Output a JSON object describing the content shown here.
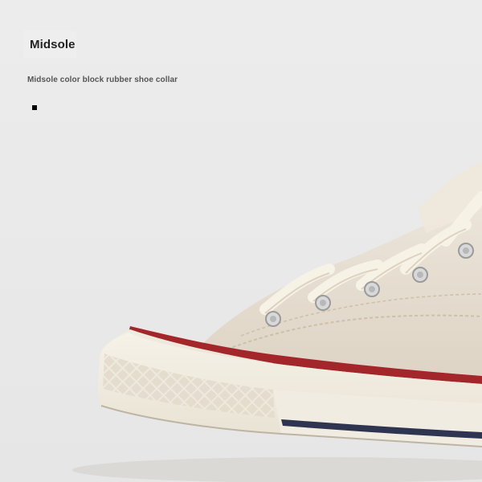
{
  "heading": {
    "title": "Midsole",
    "description": "Midsole color block rubber shoe collar"
  },
  "image": {
    "subject": "cream high-top canvas sneaker",
    "colors": {
      "canvas": "#e6ddd0",
      "rubber": "#f3efe3",
      "red_stripe": "#a3262b",
      "navy_stripe": "#2f3550",
      "laces": "#f7f2e6"
    }
  }
}
